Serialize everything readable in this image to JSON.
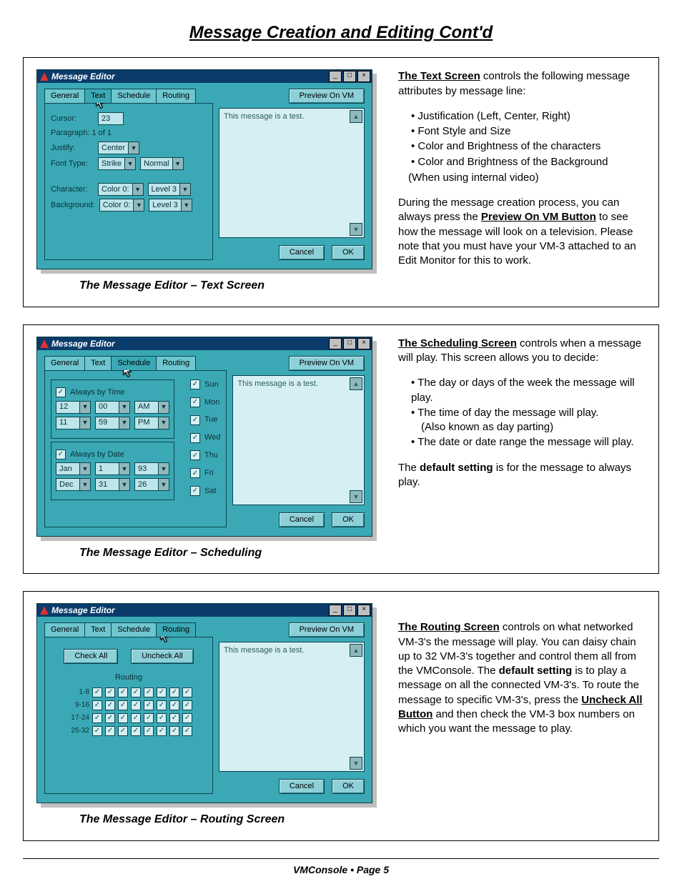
{
  "page_title": "Message Creation and Editing Cont'd",
  "footer": "VMConsole • Page 5",
  "window_common": {
    "title": "Message Editor",
    "preview_btn": "Preview On VM",
    "preview_text": "This message is a test.",
    "cancel": "Cancel",
    "ok": "OK",
    "tabs": {
      "general": "General",
      "text": "Text",
      "schedule": "Schedule",
      "routing": "Routing"
    }
  },
  "fig1": {
    "caption": "The Message Editor – Text Screen",
    "cursor_label": "Cursor:",
    "cursor_val": "23",
    "paragraph": "Paragraph:  1 of 1",
    "justify_label": "Justify:",
    "justify_val": "Center",
    "font_label": "Font Type:",
    "font_val": "Strike",
    "font_weight": "Normal",
    "char_label": "Character:",
    "char_color": "Color 0:",
    "char_level": "Level 3",
    "bg_label": "Background:",
    "bg_color": "Color 0:",
    "bg_level": "Level 3"
  },
  "fig2": {
    "caption": "The Message Editor – Scheduling",
    "always_time": "Always by Time",
    "time_from": {
      "h": "12",
      "m": "00",
      "ap": "AM"
    },
    "time_to": {
      "h": "11",
      "m": "59",
      "ap": "PM"
    },
    "always_date": "Always by Date",
    "date_from": {
      "mo": "Jan",
      "d": "1",
      "y": "93"
    },
    "date_to": {
      "mo": "Dec",
      "d": "31",
      "y": "26"
    },
    "days": [
      "Sun",
      "Mon",
      "Tue",
      "Wed",
      "Thu",
      "Fri",
      "Sat"
    ]
  },
  "fig3": {
    "caption": "The Message Editor – Routing Screen",
    "check_all": "Check All",
    "uncheck_all": "Uncheck All",
    "routing_label": "Routing",
    "ranges": [
      "1-8",
      "9-16",
      "17-24",
      "25-32"
    ]
  },
  "text1": {
    "heading": "The Text Screen",
    "intro_tail": " controls the following message attributes by message line:",
    "bullets": [
      "Justification (Left, Center, Right)",
      "Font Style and Size",
      "Color and Brightness of the characters",
      "Color and Brightness of the Background"
    ],
    "bullet4_sub": "(When using internal video)",
    "p2a": "During the message creation process, you can always press the ",
    "p2_bold": "Preview On VM Button",
    "p2b": " to see how the message will look on a television. Please note that you must have your VM-3 attached to an Edit Monitor for this to work."
  },
  "text2": {
    "heading": "The Scheduling Screen",
    "intro_tail": " controls when a message will play. This screen allows you to decide:",
    "bullets_a": "The day or days of the week the message will play.",
    "bullets_b1": "The time of day the message will play.",
    "bullets_b2": "(Also known as day parting)",
    "bullets_c": "The date or date range the message will play.",
    "p2a": "The ",
    "p2_bold": "default setting",
    "p2b": " is for the message to always play."
  },
  "text3": {
    "heading": "The Routing Screen",
    "p1a": " controls on what networked VM-3's the message will play. You can daisy chain up to 32 VM-3's together and control them all from the VMConsole. The ",
    "p1_bold1": "default setting",
    "p1b": " is to play a message on all the connected VM-3's. To route the message to specific VM-3's, press the ",
    "p1_bold2": "Uncheck All Button",
    "p1c": " and then check the VM-3 box numbers on which you want the message to play."
  }
}
